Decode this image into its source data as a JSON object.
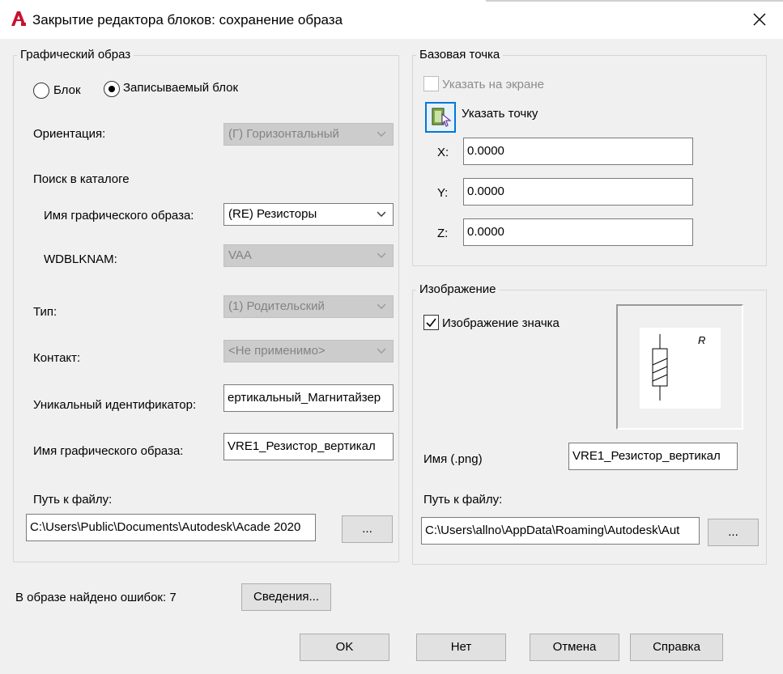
{
  "window": {
    "title": "Закрытие редактора блоков: сохранение образа"
  },
  "graphic_group": {
    "legend": "Графический образ",
    "radio_block": "Блок",
    "radio_writable_block": "Записываемый блок",
    "selected_radio": "Записываемый блок",
    "orientation_label": "Ориентация:",
    "orientation_value": "(Г) Горизонтальный",
    "catalog_search_label": "Поиск в каталоге",
    "symbol_name_label": "Имя графического образа:",
    "symbol_name_value": "(RE) Резисторы",
    "wdblknam_label": "WDBLKNAM:",
    "wdblknam_value": "VAA",
    "type_label": "Тип:",
    "type_value": "(1) Родительский",
    "contact_label": "Контакт:",
    "contact_value": "<Не применимо>",
    "unique_id_label": "Уникальный идентификатор:",
    "unique_id_value": "ертикальный_Магнитайзер",
    "image_name_label": "Имя графического образа:",
    "image_name_value": "VRE1_Резистор_вертикал",
    "file_path_label": "Путь к файлу:",
    "file_path_value": "C:\\Users\\Public\\Documents\\Autodesk\\Acade 2020",
    "browse_label": "..."
  },
  "base_point_group": {
    "legend": "Базовая точка",
    "specify_on_screen_label": "Указать на экране",
    "specify_on_screen_checked": false,
    "pick_point_label": "Указать точку",
    "x_label": "X:",
    "x_value": "0.0000",
    "y_label": "Y:",
    "y_value": "0.0000",
    "z_label": "Z:",
    "z_value": "0.0000"
  },
  "image_group": {
    "legend": "Изображение",
    "icon_image_label": "Изображение значка",
    "icon_image_checked": true,
    "preview_text": "R",
    "name_label": "Имя (.png)",
    "name_value": "VRE1_Резистор_вертикал",
    "file_path_label": "Путь к файлу:",
    "file_path_value": "C:\\Users\\allno\\AppData\\Roaming\\Autodesk\\Aut",
    "browse_label": "..."
  },
  "footer": {
    "errors_text": "В образе найдено ошибок: 7",
    "details_label": "Сведения...",
    "ok_label": "OK",
    "no_label": "Нет",
    "cancel_label": "Отмена",
    "help_label": "Справка"
  },
  "colors": {
    "accent": "#0078d7",
    "app_icon_red": "#c8102e",
    "disabled_field": "#cccccc"
  }
}
